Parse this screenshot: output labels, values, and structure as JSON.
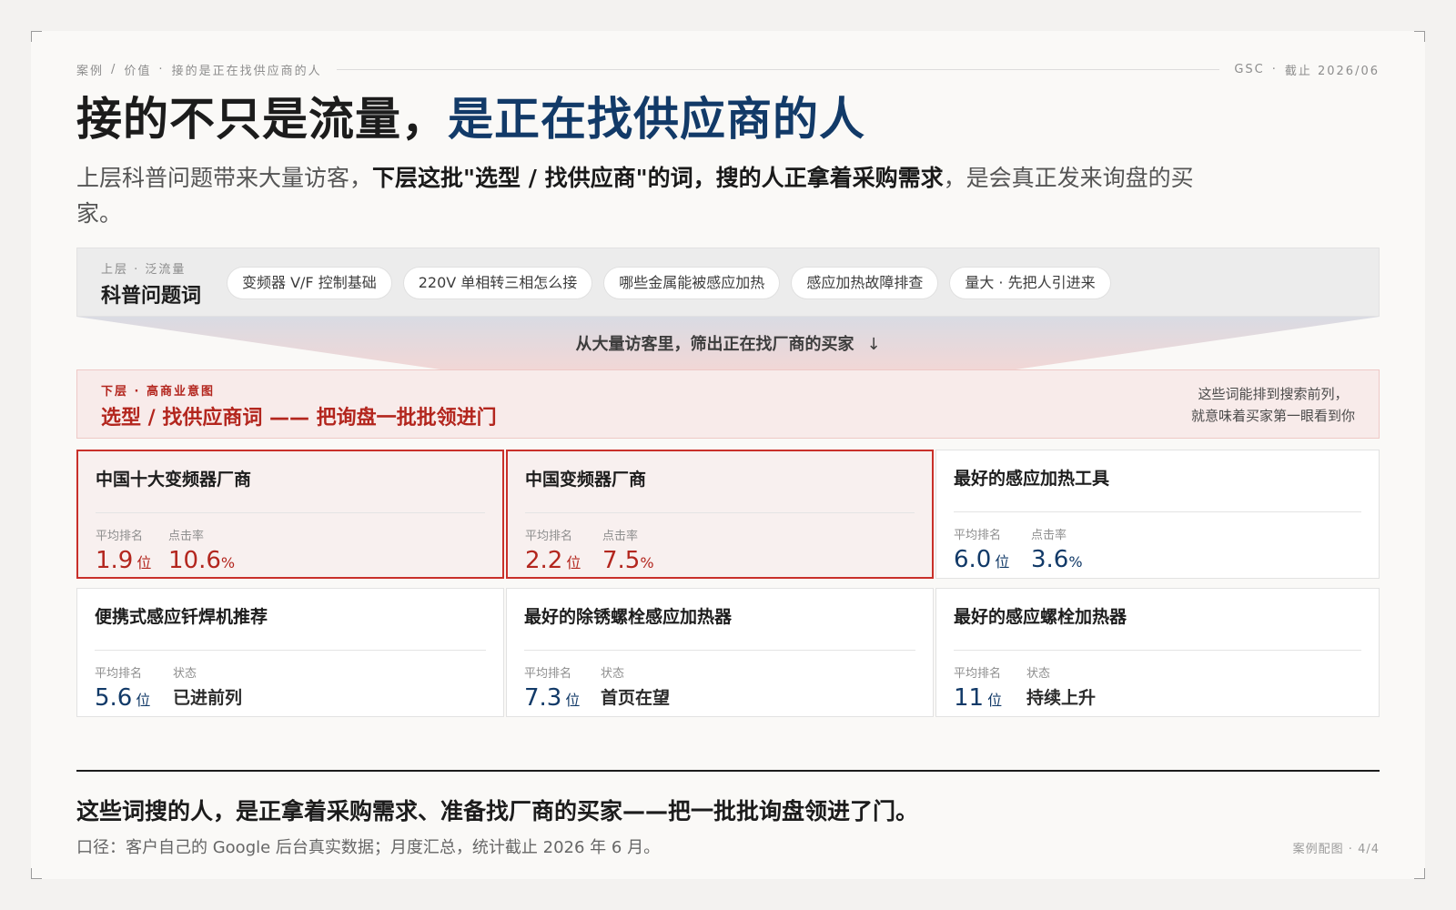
{
  "header": {
    "breadcrumb_1": "案例",
    "breadcrumb_2": "价值",
    "breadcrumb_3": "接的是正在找供应商的人",
    "source_tag": "GSC",
    "date_tag": "截止 2026/06"
  },
  "headline": {
    "part1": "接的不只是流量，",
    "part2": "是正在找供应商的人"
  },
  "lede": {
    "part1": "上层科普问题带来大量访客，",
    "part2": "下层这批\"选型 / 找供应商\"的词，搜的人正拿着采购需求",
    "part3": "，是会真正发来询盘的买家。"
  },
  "upper": {
    "tag": "上层 · 泛流量",
    "name": "科普问题词",
    "chips": [
      "变频器 V/F 控制基础",
      "220V 单相转三相怎么接",
      "哪些金属能被感应加热",
      "感应加热故障排查",
      "量大 · 先把人引进来"
    ]
  },
  "funnel": {
    "label": "从大量访客里，筛出正在找厂商的买家",
    "arrow": "↓"
  },
  "lower": {
    "tag": "下层 · 高商业意图",
    "name": "选型 / 找供应商词 —— 把询盘一批批领进门",
    "note_line1": "这些词能排到搜索前列，",
    "note_line2": "就意味着买家第一眼看到你"
  },
  "cards": [
    {
      "title": "中国十大变频器厂商",
      "rank_label": "平均排名",
      "rank": "1.9",
      "rank_unit": "位",
      "second_label": "点击率",
      "second_value": "10.6",
      "second_unit": "%",
      "highlight": true
    },
    {
      "title": "中国变频器厂商",
      "rank_label": "平均排名",
      "rank": "2.2",
      "rank_unit": "位",
      "second_label": "点击率",
      "second_value": "7.5",
      "second_unit": "%",
      "highlight": true
    },
    {
      "title": "最好的感应加热工具",
      "rank_label": "平均排名",
      "rank": "6.0",
      "rank_unit": "位",
      "second_label": "点击率",
      "second_value": "3.6",
      "second_unit": "%",
      "highlight": false
    },
    {
      "title": "便携式感应钎焊机推荐",
      "rank_label": "平均排名",
      "rank": "5.6",
      "rank_unit": "位",
      "second_label": "状态",
      "second_value": "已进前列",
      "second_unit": "",
      "highlight": false
    },
    {
      "title": "最好的除锈螺栓感应加热器",
      "rank_label": "平均排名",
      "rank": "7.3",
      "rank_unit": "位",
      "second_label": "状态",
      "second_value": "首页在望",
      "second_unit": "",
      "highlight": false
    },
    {
      "title": "最好的感应螺栓加热器",
      "rank_label": "平均排名",
      "rank": "11",
      "rank_unit": "位",
      "second_label": "状态",
      "second_value": "持续上升",
      "second_unit": "",
      "highlight": false
    }
  ],
  "footer": {
    "conclusion": "这些词搜的人，是正拿着采购需求、准备找厂商的买家——把一批批询盘领进了门。",
    "source": "口径：客户自己的 Google 后台真实数据；月度汇总，统计截止 2026 年 6 月。",
    "page_label": "案例配图",
    "page_number": "4/4"
  },
  "colors": {
    "accent_navy": "#123a68",
    "accent_red": "#b3261e",
    "card_highlight_border": "#c9302a"
  }
}
